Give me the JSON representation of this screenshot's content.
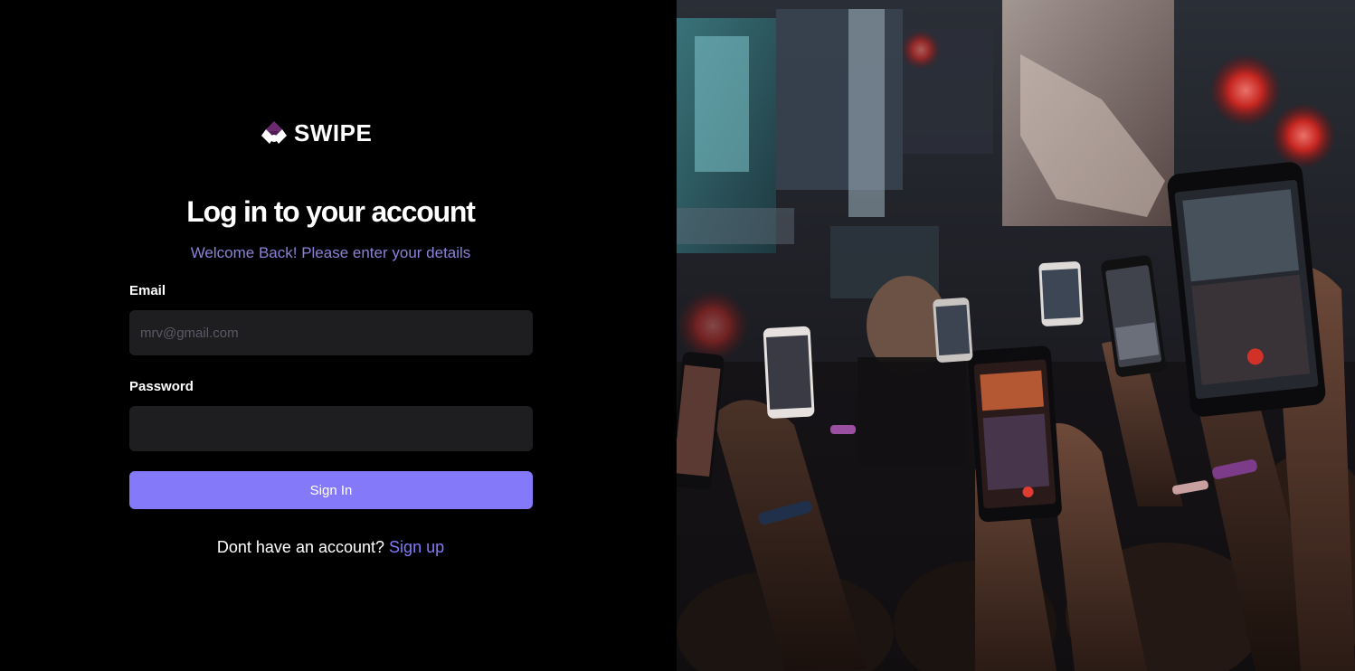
{
  "brand": {
    "name": "SWIPE",
    "logo_icon": "swipe-logo-icon",
    "logo_color": "#6b2a6f"
  },
  "login": {
    "title": "Log in to your account",
    "subtitle": "Welcome Back! Please enter your details",
    "email_label": "Email",
    "email_placeholder": "mrv@gmail.com",
    "password_label": "Password",
    "password_value": "",
    "submit_label": "Sign In",
    "signup_prompt": "Dont have an account?",
    "signup_link": "Sign up"
  },
  "colors": {
    "accent": "#8479f9",
    "subtitle": "#8a82d8",
    "input_bg": "#1e1e21",
    "background": "#000000"
  },
  "hero_image": {
    "subject": "concert-crowd-phones-photo"
  }
}
